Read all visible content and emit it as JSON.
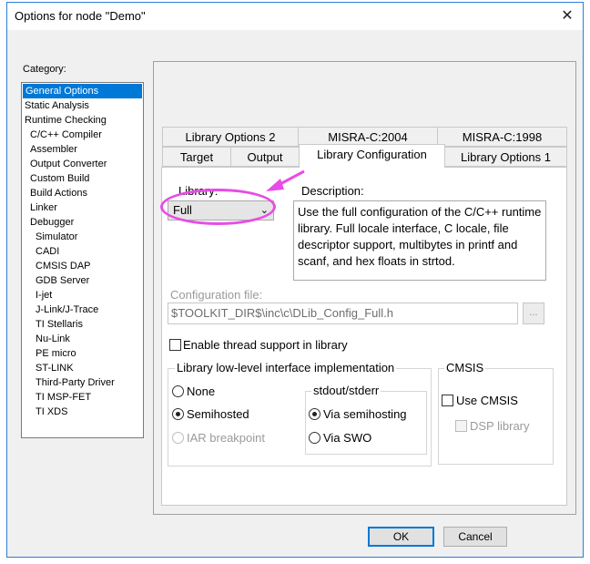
{
  "window": {
    "title": "Options for node \"Demo\"",
    "close_glyph": "✕"
  },
  "category": {
    "label": "Category:",
    "items": [
      {
        "label": "General Options",
        "level": 0,
        "selected": true
      },
      {
        "label": "Static Analysis",
        "level": 0
      },
      {
        "label": "Runtime Checking",
        "level": 0
      },
      {
        "label": "C/C++ Compiler",
        "level": 1
      },
      {
        "label": "Assembler",
        "level": 1
      },
      {
        "label": "Output Converter",
        "level": 1
      },
      {
        "label": "Custom Build",
        "level": 1
      },
      {
        "label": "Build Actions",
        "level": 1
      },
      {
        "label": "Linker",
        "level": 1
      },
      {
        "label": "Debugger",
        "level": 1
      },
      {
        "label": "Simulator",
        "level": 2
      },
      {
        "label": "CADI",
        "level": 2
      },
      {
        "label": "CMSIS DAP",
        "level": 2
      },
      {
        "label": "GDB Server",
        "level": 2
      },
      {
        "label": "I-jet",
        "level": 2
      },
      {
        "label": "J-Link/J-Trace",
        "level": 2
      },
      {
        "label": "TI Stellaris",
        "level": 2
      },
      {
        "label": "Nu-Link",
        "level": 2
      },
      {
        "label": "PE micro",
        "level": 2
      },
      {
        "label": "ST-LINK",
        "level": 2
      },
      {
        "label": "Third-Party Driver",
        "level": 2
      },
      {
        "label": "TI MSP-FET",
        "level": 2
      },
      {
        "label": "TI XDS",
        "level": 2
      }
    ]
  },
  "tabs": {
    "row_back": [
      "Library Options 2",
      "MISRA-C:2004",
      "MISRA-C:1998"
    ],
    "row_front": [
      "Target",
      "Output",
      "Library Configuration",
      "Library Options 1"
    ],
    "active": "Library Configuration"
  },
  "library": {
    "label": "Library:",
    "value": "Full",
    "description_label": "Description:",
    "description": "Use the full configuration of the C/C++ runtime library. Full locale interface, C locale, file descriptor support, multibytes in printf and scanf, and hex floats in strtod."
  },
  "config_file": {
    "label": "Configuration file:",
    "value": "$TOOLKIT_DIR$\\inc\\c\\DLib_Config_Full.h",
    "browse_label": "..."
  },
  "thread_support": {
    "label": "Enable thread support in library",
    "checked": false
  },
  "low_level": {
    "title": "Library low-level interface implementation",
    "options": [
      {
        "label": "None",
        "checked": false,
        "disabled": false
      },
      {
        "label": "Semihosted",
        "checked": true,
        "disabled": false
      },
      {
        "label": "IAR breakpoint",
        "checked": false,
        "disabled": true
      }
    ],
    "stdout": {
      "title": "stdout/stderr",
      "options": [
        {
          "label": "Via semihosting",
          "checked": true
        },
        {
          "label": "Via SWO",
          "checked": false
        }
      ]
    }
  },
  "cmsis": {
    "title": "CMSIS",
    "use_cmsis": "Use CMSIS",
    "dsp_library": "DSP library"
  },
  "buttons": {
    "ok": "OK",
    "cancel": "Cancel"
  },
  "annotation_color": "#e84ce6",
  "accent_color": "#0078d7"
}
